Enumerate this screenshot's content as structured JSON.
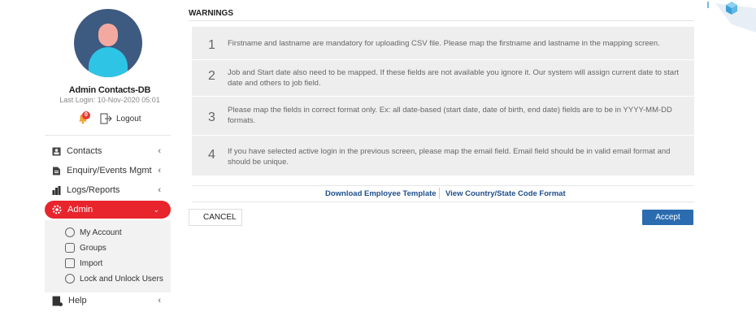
{
  "user": {
    "name": "Admin Contacts-DB",
    "last_login": "Last Login: 10-Nov-2020 05:01",
    "notification_count": "0",
    "logout_label": "Logout"
  },
  "nav": {
    "contacts": "Contacts",
    "enquiry": "Enquiry/Events Mgmt",
    "logs": "Logs/Reports",
    "admin": "Admin",
    "help": "Help",
    "chevron_left": "‹",
    "chevron_down": "⌄"
  },
  "admin_submenu": [
    "My Account",
    "Groups",
    "Import",
    "Lock and Unlock Users"
  ],
  "warnings": {
    "title": "WARNINGS",
    "items": [
      {
        "num": "1",
        "text": "Firstname and lastname are mandatory for uploading CSV file. Please map the firstname and lastname in the mapping screen."
      },
      {
        "num": "2",
        "text": "Job and Start date also need to be mapped. If these fields are not available you ignore it. Our system will assign current date to start date and others to job field."
      },
      {
        "num": "3",
        "text": "Please map the fields in correct format only. Ex: all date-based (start date, date of birth, end date) fields are to be in YYYY-MM-DD formats."
      },
      {
        "num": "4",
        "text": "If you have selected active login in the previous screen, please map the email field. Email field should be in valid email format and should be unique."
      }
    ]
  },
  "links": {
    "download_template": "Download Employee Template",
    "view_codes": "View Country/State Code Format"
  },
  "buttons": {
    "cancel": "CANCEL",
    "accept": "Accept"
  },
  "colors": {
    "active_nav": "#e8242c",
    "accept": "#2b6cb0",
    "link": "#1e4e8c",
    "warning_bg": "#eeeeee"
  }
}
